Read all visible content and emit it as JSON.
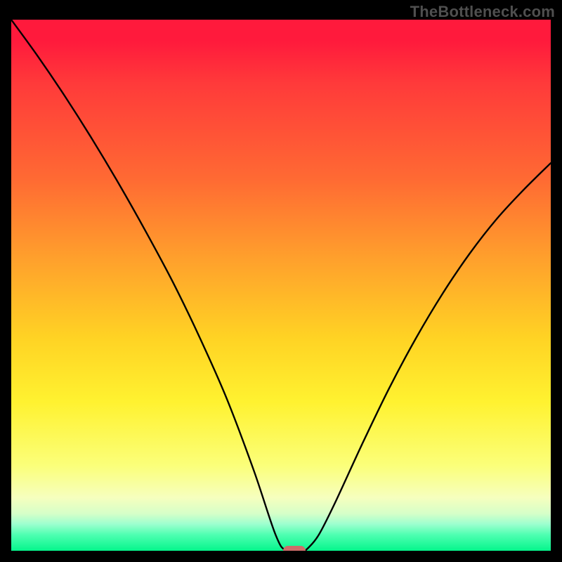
{
  "watermark": {
    "text": "TheBottleneck.com"
  },
  "colors": {
    "background": "#000000",
    "watermark": "#4f4f4f",
    "curve": "#000000",
    "marker": "#cd6d6a",
    "gradient_top": "#ff1a3c",
    "gradient_bottom": "#05f58c"
  },
  "chart_data": {
    "type": "line",
    "title": "",
    "xlabel": "",
    "ylabel": "",
    "xlim": [
      0,
      100
    ],
    "ylim": [
      0,
      100
    ],
    "grid": false,
    "legend": false,
    "series": [
      {
        "name": "bottleneck-curve",
        "x": [
          0,
          5,
          10,
          15,
          20,
          25,
          30,
          35,
          40,
          45,
          49,
          51,
          54,
          55,
          57,
          60,
          65,
          70,
          75,
          80,
          85,
          90,
          95,
          100
        ],
        "values": [
          100,
          93,
          85.5,
          77.5,
          69,
          60,
          50.5,
          40,
          28.5,
          15,
          3,
          0,
          0,
          0.5,
          3,
          9,
          20,
          30.5,
          40,
          48.5,
          56,
          62.5,
          68,
          73
        ]
      }
    ],
    "annotations": [
      {
        "name": "optimal-marker",
        "x": 52.5,
        "y": 0,
        "shape": "rounded-rect"
      }
    ]
  }
}
